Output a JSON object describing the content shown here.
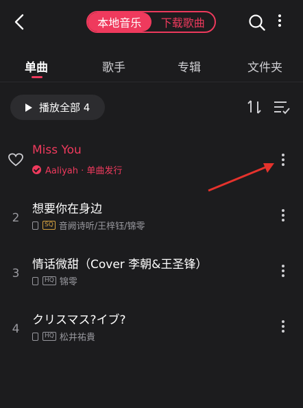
{
  "header": {
    "segments": [
      "本地音乐",
      "下载歌曲"
    ],
    "active_segment": 0
  },
  "tabs": [
    "单曲",
    "歌手",
    "专辑",
    "文件夹"
  ],
  "active_tab": 0,
  "toolbar": {
    "play_all_label": "播放全部 4"
  },
  "songs": [
    {
      "index": "",
      "title": "Miss You",
      "subtitle": "Aaliyah · 单曲发行",
      "playing": true,
      "badge": ""
    },
    {
      "index": "2",
      "title": "想要你在身边",
      "subtitle": "音阙诗听/王梓钰/锦零",
      "playing": false,
      "badge": "SQ"
    },
    {
      "index": "3",
      "title": "情话微甜（Cover 李朝&王圣锋）",
      "subtitle": "锦零",
      "playing": false,
      "badge": "HQ"
    },
    {
      "index": "4",
      "title": "クリスマス?イブ?",
      "subtitle": "松井祐貴",
      "playing": false,
      "badge": "HQ"
    }
  ],
  "colors": {
    "accent": "#ef3a5d",
    "background": "#1c1c1e",
    "annotation_arrow": "#e5322c"
  },
  "icons": [
    "back-arrow-icon",
    "search-icon",
    "more-vertical-icon",
    "play-icon",
    "sort-icon",
    "multi-select-icon",
    "heart-icon",
    "verified-icon",
    "phone-icon"
  ]
}
